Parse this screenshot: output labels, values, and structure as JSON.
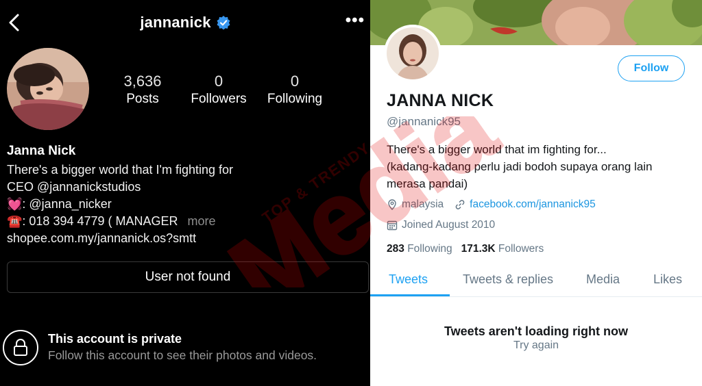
{
  "instagram": {
    "handle": "jannanick",
    "more_menu": "•••",
    "stats": [
      {
        "num": "3,636",
        "label": "Posts"
      },
      {
        "num": "0",
        "label": "Followers"
      },
      {
        "num": "0",
        "label": "Following"
      }
    ],
    "name": "Janna Nick",
    "bio": [
      "There's a bigger world that I'm fighting for",
      "CEO @jannanickstudios",
      "💓: @janna_nicker",
      "☎️: 018 394 4779 ( MANAGER"
    ],
    "more_label": "more",
    "website": "shopee.com.my/jannanick.os?smtt",
    "user_not_found": "User not found",
    "private_title": "This account is private",
    "private_subtitle": "Follow this account to see their photos and videos."
  },
  "twitter": {
    "follow_label": "Follow",
    "name": "JANNA NICK",
    "handle": "@jannanick95",
    "bio": [
      "There's a bigger world that im fighting for...",
      "(kadang-kadang perlu jadi bodoh supaya orang lain",
      "merasa pandai)"
    ],
    "location": "malaysia",
    "website": "facebook.com/jannanick95",
    "joined": "Joined August 2010",
    "following_count": "283",
    "following_label": "Following",
    "followers_count": "171.3K",
    "followers_label": "Followers",
    "tabs": [
      "Tweets",
      "Tweets & replies",
      "Media",
      "Likes"
    ],
    "active_tab": "Tweets",
    "empty_title": "Tweets aren't loading right now",
    "retry_label": "Try again"
  },
  "watermark": {
    "big": "Media",
    "small": "TOP & TRENDY"
  },
  "colors": {
    "twitter_blue": "#1da1f2",
    "ig_bg": "#000000",
    "watermark_red": "#e00000"
  }
}
